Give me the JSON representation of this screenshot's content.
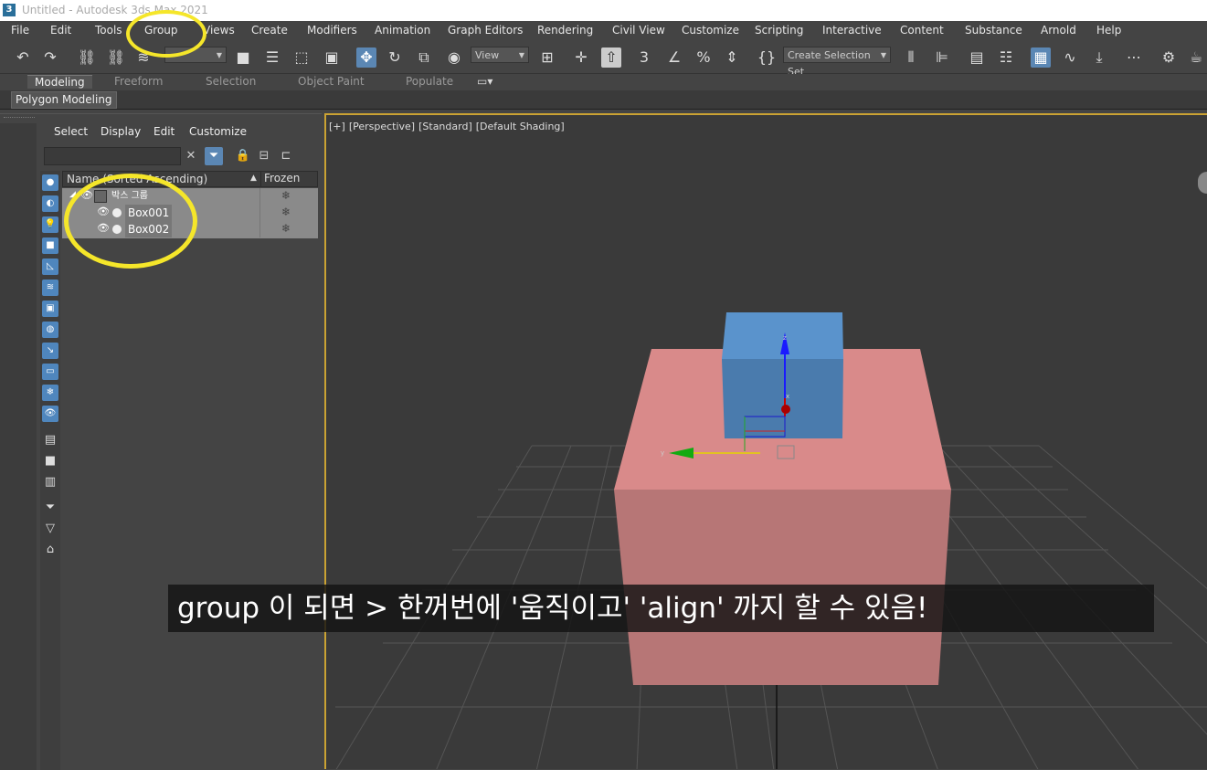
{
  "titlebar": {
    "title": "Untitled - Autodesk 3ds Max 2021",
    "app_icon": "3"
  },
  "menu": [
    "File",
    "Edit",
    "Tools",
    "Group",
    "Views",
    "Create",
    "Modifiers",
    "Animation",
    "Graph Editors",
    "Rendering",
    "Civil View",
    "Customize",
    "Scripting",
    "Interactive",
    "Content",
    "Substance",
    "Arnold",
    "Help"
  ],
  "toolbar": {
    "view_dropdown": "View",
    "selection_set": "Create Selection Set"
  },
  "ribbon": {
    "tabs": [
      "Modeling",
      "Freeform",
      "Selection",
      "Object Paint",
      "Populate"
    ],
    "active": "Modeling",
    "sub": "Polygon Modeling"
  },
  "scene_explorer": {
    "menu": [
      "Select",
      "Display",
      "Edit",
      "Customize"
    ],
    "col_name": "Name (Sorted Ascending)",
    "col_frozen": "Frozen",
    "rows": [
      {
        "label": "박스 그룹",
        "type": "group",
        "frozen": "❄"
      },
      {
        "label": "Box001",
        "type": "object",
        "frozen": "❄"
      },
      {
        "label": "Box002",
        "type": "object",
        "frozen": "❄"
      }
    ]
  },
  "viewport": {
    "labels": [
      "[+]",
      "[Perspective]",
      "[Standard]",
      "[Default Shading]"
    ]
  },
  "gizmo": {
    "z": "z",
    "x": "x",
    "y": "y"
  },
  "caption": "group 이 되면 > 한꺼번에 '움직이고' 'align' 까지 할 수 있음!",
  "colors": {
    "accent": "#5b87b4",
    "highlight_circle": "#f5e62a",
    "box_pink": "#d98a8a",
    "box_blue": "#4e86bf",
    "viewport_border": "#caa233"
  }
}
